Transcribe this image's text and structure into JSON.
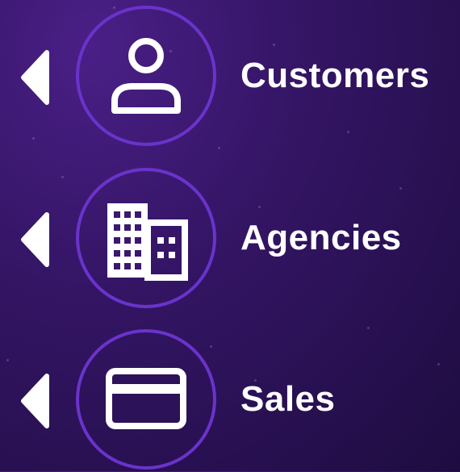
{
  "menu": {
    "items": [
      {
        "label": "Customers",
        "icon": "user-icon"
      },
      {
        "label": "Agencies",
        "icon": "building-icon"
      },
      {
        "label": "Sales",
        "icon": "credit-card-icon"
      }
    ]
  },
  "colors": {
    "background_top": "#4a1f86",
    "background_bottom": "#1e0c40",
    "circle_border": "#6a33cc",
    "text": "#ffffff"
  }
}
